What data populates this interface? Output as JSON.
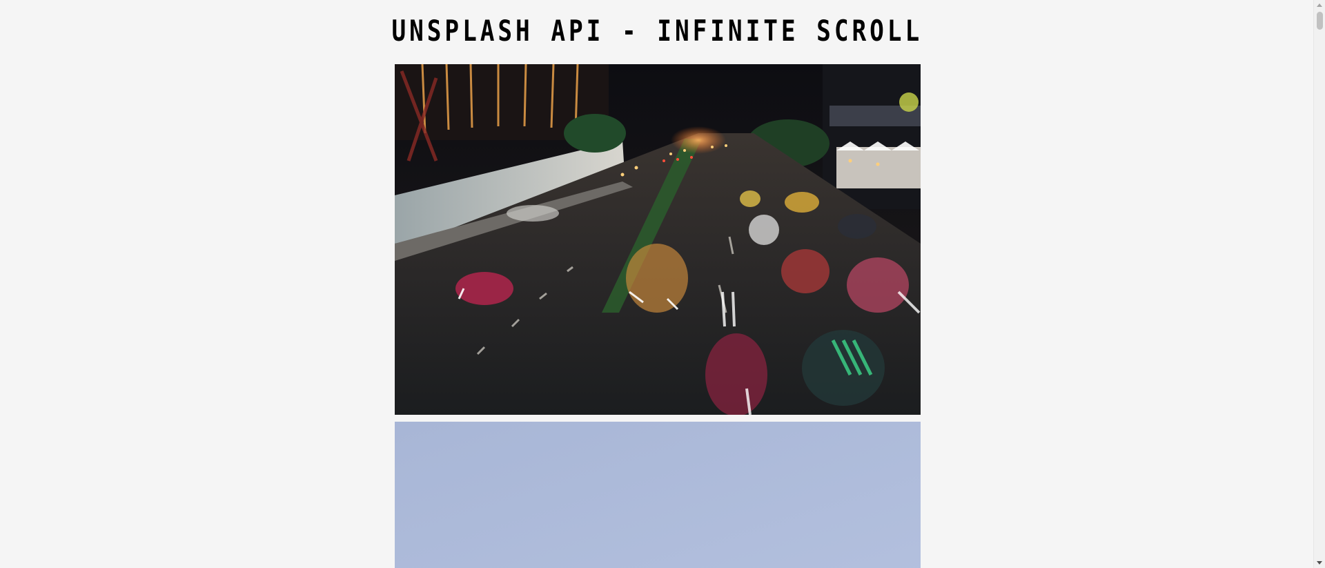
{
  "header": {
    "title": "UNSPLASH API - INFINITE SCROLL"
  },
  "images": [
    {
      "icon": "photo-city-traffic-night",
      "alt": ""
    },
    {
      "icon": "photo-blue-sky",
      "alt": ""
    }
  ],
  "colors": {
    "background": "#f5f5f5",
    "title": "#000000",
    "sky": "#a9b7d6"
  }
}
